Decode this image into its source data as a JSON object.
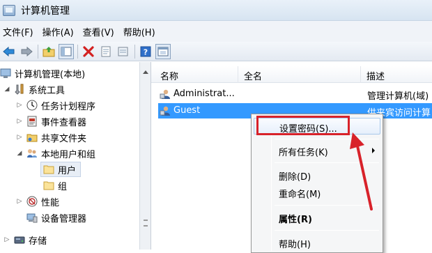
{
  "window": {
    "title": "计算机管理"
  },
  "menu": [
    "文件(F)",
    "操作(A)",
    "查看(V)",
    "帮助(H)"
  ],
  "toolbar": {
    "icons": [
      "back-icon",
      "forward-icon",
      "up-folder-icon",
      "show-hide-tree-icon",
      "delete-icon",
      "properties-icon",
      "export-list-icon",
      "help-icon",
      "console-icon"
    ]
  },
  "tree": {
    "root": "计算机管理(本地)",
    "system_tools": "系统工具",
    "task_scheduler": "任务计划程序",
    "event_viewer": "事件查看器",
    "shared_folders": "共享文件夹",
    "local_users_groups": "本地用户和组",
    "users": "用户",
    "groups": "组",
    "performance": "性能",
    "device_manager": "设备管理器",
    "storage": "存储"
  },
  "list": {
    "columns": [
      "名称",
      "全名",
      "描述"
    ],
    "rows": [
      {
        "name": "Administrat...",
        "fullname": "",
        "description": "管理计算机(域)"
      },
      {
        "name": "Guest",
        "fullname": "",
        "description": "供来宾访问计算"
      }
    ]
  },
  "context_menu": {
    "set_password": "设置密码(S)...",
    "all_tasks": "所有任务(K)",
    "delete": "删除(D)",
    "rename": "重命名(M)",
    "properties": "属性(R)",
    "help": "帮助(H)"
  },
  "colors": {
    "selection": "#3399ff",
    "highlight_annotation": "#d8222a"
  }
}
